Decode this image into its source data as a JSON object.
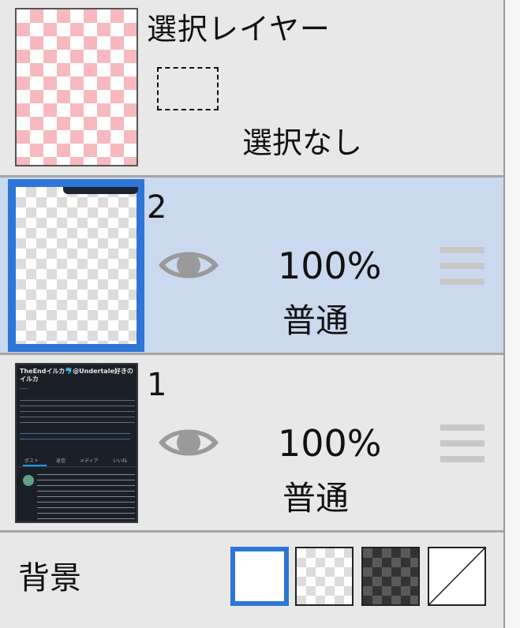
{
  "selection_layer": {
    "title": "選択レイヤー",
    "status": "選択なし"
  },
  "layers": [
    {
      "name": "2",
      "opacity": "100%",
      "blend_mode": "普通",
      "selected": true,
      "visible": true
    },
    {
      "name": "1",
      "opacity": "100%",
      "blend_mode": "普通",
      "selected": false,
      "visible": true
    }
  ],
  "layer1_thumbnail": {
    "title": "TheEndイルカ🐬@Undertale好きのイルカ",
    "tabs": [
      "ポスト",
      "返信",
      "メディア",
      "いいね"
    ]
  },
  "background": {
    "label": "背景",
    "options": [
      "white",
      "light-checker",
      "dark-checker",
      "none"
    ],
    "selected": "white"
  },
  "colors": {
    "selected_row_bg": "#cbd9ee",
    "selected_accent": "#2e76d6",
    "panel_bg": "#e8e8e8",
    "selection_checker": "#f7b9bf"
  }
}
